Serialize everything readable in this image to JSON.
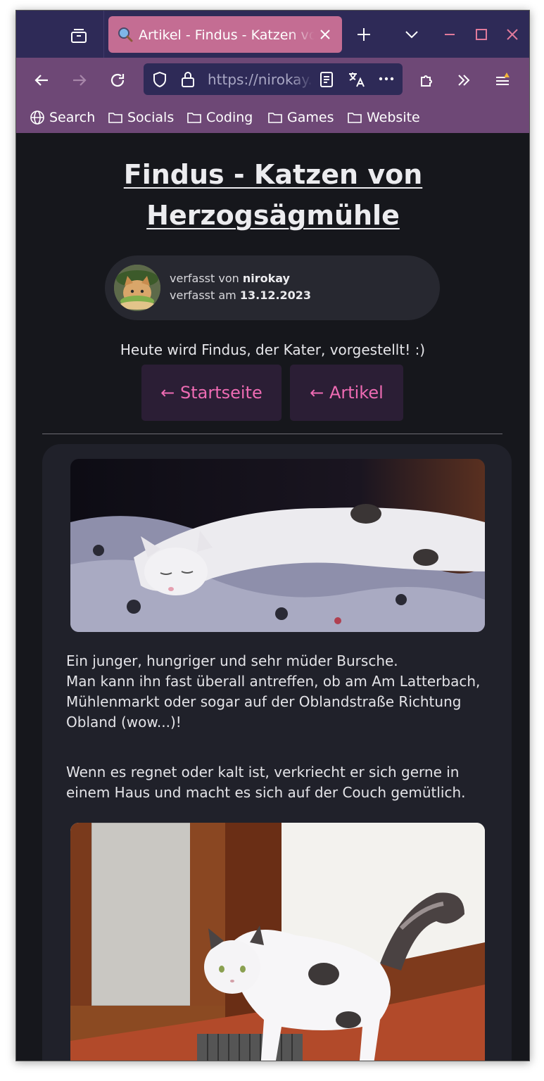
{
  "browser": {
    "tab_title": "Artikel - Findus - Katzen von Herzogsägmühle",
    "url": "https://nirokay.",
    "bookmarks": [
      "Search",
      "Socials",
      "Coding",
      "Games",
      "Website"
    ]
  },
  "colors": {
    "tabbar_bg": "#2e2a57",
    "navbar_bg": "#6e4876",
    "active_tab": "#c46d93",
    "page_bg": "#16171c",
    "card_bg": "#20212a",
    "link_color": "#ee6bb3"
  },
  "article": {
    "title": "Findus - Katzen von Herzogsägmühle",
    "author_prefix": "verfasst von ",
    "author": "nirokay",
    "date_prefix": "verfasst am ",
    "date": "13.12.2023",
    "summary": "Heute wird Findus, der Kater, vorgestellt! :)",
    "btn_home": "← Startseite",
    "btn_articles": "← Artikel",
    "para1_lines": [
      "Ein junger, hungriger und sehr müder Bursche.",
      "Man kann ihn fast überall antreffen, ob am Am Latterbach, Mühlenmarkt oder sogar auf der Oblandstraße Richtung Obland (wow...)!"
    ],
    "para2": "Wenn es regnet oder kalt ist, verkriecht er sich gerne in einem Haus und macht es sich auf der Couch gemütlich."
  }
}
